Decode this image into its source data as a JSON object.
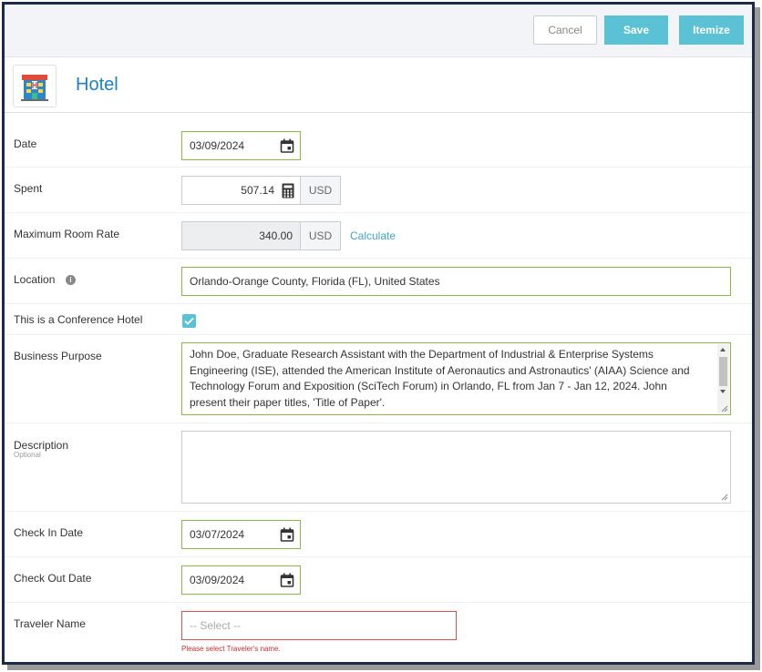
{
  "toolbar": {
    "cancel_label": "Cancel",
    "save_label": "Save",
    "itemize_label": "Itemize"
  },
  "header": {
    "title": "Hotel",
    "icon": "hotel-icon"
  },
  "form": {
    "date": {
      "label": "Date",
      "value": "03/09/2024"
    },
    "spent": {
      "label": "Spent",
      "value": "507.14",
      "currency": "USD"
    },
    "max_room_rate": {
      "label": "Maximum Room Rate",
      "value": "340.00",
      "currency": "USD",
      "calculate_label": "Calculate"
    },
    "location": {
      "label": "Location",
      "value": "Orlando-Orange County, Florida (FL), United States"
    },
    "conference_hotel": {
      "label": "This is a Conference Hotel",
      "checked": true
    },
    "business_purpose": {
      "label": "Business Purpose",
      "value": "John Doe, Graduate Research Assistant with the Department of Industrial & Enterprise Systems Engineering (ISE), attended the American Institute of Aeronautics and Astronautics' (AIAA) Science and Technology Forum and Exposition (SciTech Forum) in Orlando, FL from Jan 7 - Jan 12, 2024. John present their paper titles, 'Title of Paper'."
    },
    "description": {
      "label": "Description",
      "sublabel": "Optional",
      "value": ""
    },
    "check_in": {
      "label": "Check In Date",
      "value": "03/07/2024"
    },
    "check_out": {
      "label": "Check Out Date",
      "value": "03/09/2024"
    },
    "traveler_name": {
      "label": "Traveler Name",
      "placeholder": "-- Select --",
      "error": "Please select Traveler's name."
    }
  },
  "colors": {
    "accent": "#5bc2d6",
    "title": "#1f82c0",
    "valid_border": "#8cb849",
    "error": "#d9534f"
  }
}
